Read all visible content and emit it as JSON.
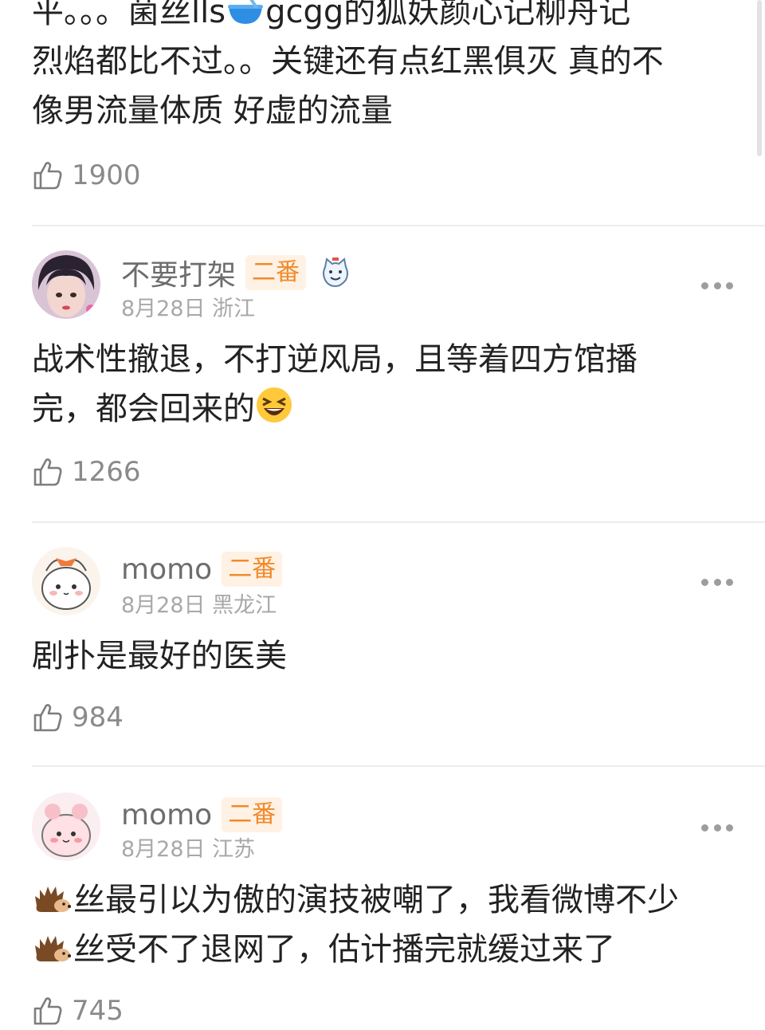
{
  "top_comment": {
    "lines": [
      "平。。。菌丝lls",
      "gcgg的狐妖颜心记柳舟记",
      "烈焰都比不过。。关键还有点红黑俱灭 真的不",
      "像男流量体质 好虚的流量"
    ],
    "likes": "1900",
    "bowl_icon": "bowl-icon"
  },
  "comments": [
    {
      "user": "不要打架",
      "badge": "二番",
      "date": "8月28日",
      "location": "浙江",
      "text_line1": "战术性撤退，不打逆风局，且等着四方馆播",
      "text_line2": "完，都会回来的",
      "emoji": "laughing-emoji",
      "likes": "1266",
      "sticker": "cat-sticker-icon"
    },
    {
      "user": "momo",
      "badge": "二番",
      "date": "8月28日",
      "location": "黑龙江",
      "text_line1": "剧扑是最好的医美",
      "likes": "984"
    },
    {
      "user": "momo",
      "badge": "二番",
      "date": "8月28日",
      "location": "江苏",
      "text_line1": "丝最引以为傲的演技被嘲了，我看微博不少",
      "text_line2": "丝受不了退网了，估计播完就缓过来了",
      "emoji": "hedgehog-emoji",
      "likes": "745"
    }
  ],
  "colors": {
    "badge_bg": "#fff1e3",
    "badge_text": "#f08a2c",
    "meta_text": "#a8a8a8"
  }
}
